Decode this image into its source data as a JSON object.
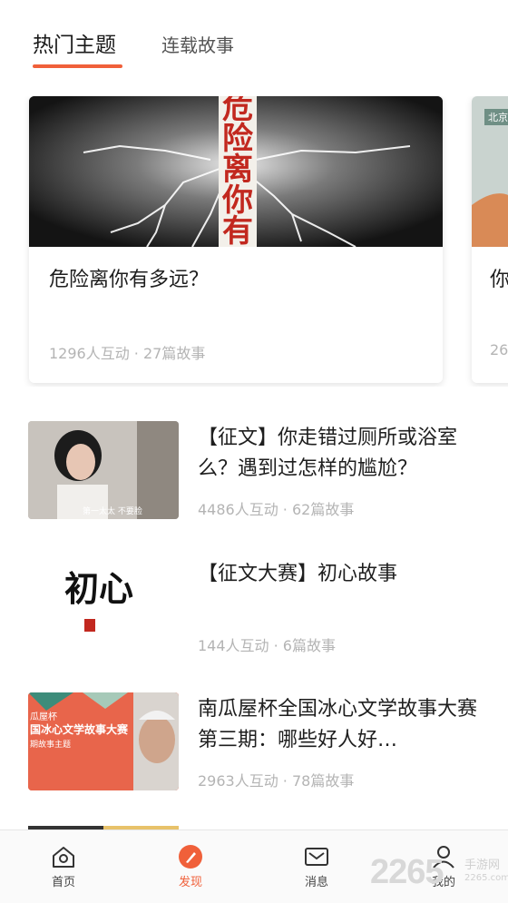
{
  "tabs": {
    "active": "热门主题",
    "inactive": "连载故事"
  },
  "featured": {
    "image_text": "危险离你有",
    "title": "危险离你有多远？",
    "meta": "1296人互动 · 27篇故事"
  },
  "peek": {
    "tag": "北京",
    "title": "你",
    "meta": "26"
  },
  "stories": [
    {
      "title": "【征文】你走错过厕所或浴室么？遇到过怎样的尴尬？",
      "meta": "4486人互动 · 62篇故事",
      "thumb_caption": "第一太太 不要脸"
    },
    {
      "title": "【征文大赛】初心故事",
      "meta": "144人互动 · 6篇故事",
      "thumb_text": "初心"
    },
    {
      "title": "南瓜屋杯全国冰心文学故事大赛第三期：哪些好人好…",
      "meta": "2963人互动 · 78篇故事",
      "thumb_line1": "瓜屋杯",
      "thumb_line2": "国冰心文学故事大赛",
      "thumb_line3": "期故事主题"
    }
  ],
  "nav": {
    "home": "首页",
    "discover": "发现",
    "message": "消息",
    "mine": "我的"
  },
  "watermark": {
    "brand": "2265",
    "sub": "手游网",
    "url": "2265.com"
  },
  "colors": {
    "accent": "#f0603a",
    "meta_gray": "#b4b4b4"
  }
}
